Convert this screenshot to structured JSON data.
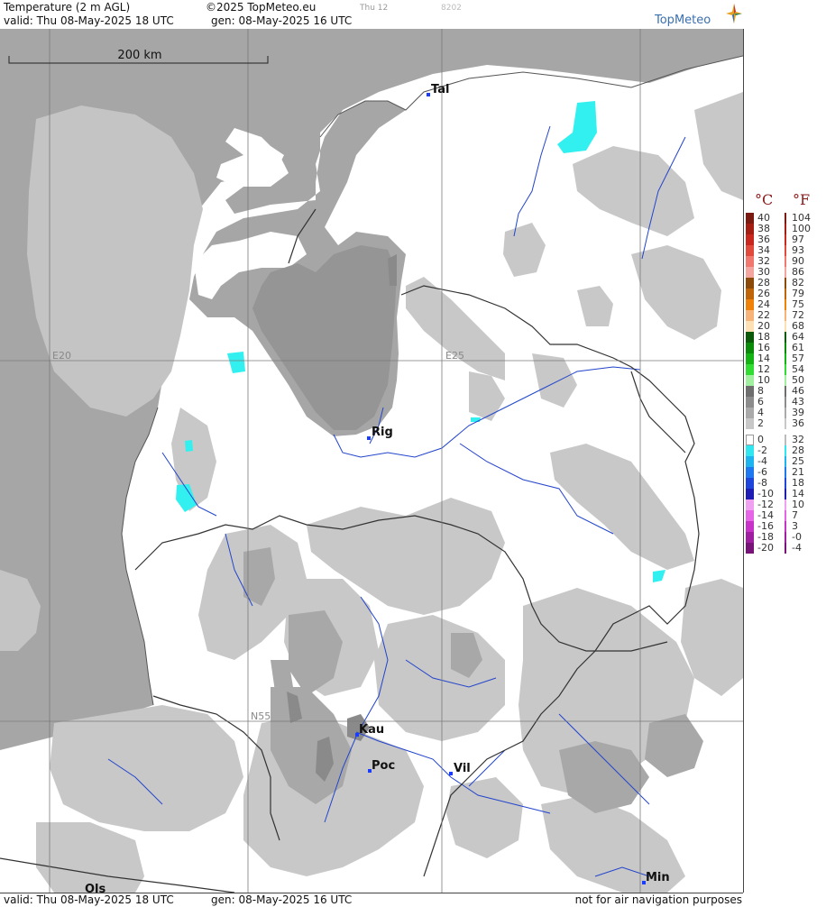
{
  "header": {
    "title": "Temperature (2 m AGL)",
    "copyright": "©2025 TopMeteo.eu",
    "run_label": "Thu 12",
    "code": "8202",
    "valid": "valid:  Thu  08-May-2025  18 UTC",
    "generated": "gen: 08-May-2025 16 UTC",
    "logo": "TopMeteo"
  },
  "map": {
    "scale_label": "200 km",
    "grid_labels": {
      "lon_20": "E20",
      "lon_25": "E25",
      "lat_55": "N55"
    },
    "cities": [
      {
        "label": "Tal"
      },
      {
        "label": "Rig"
      },
      {
        "label": "Kau"
      },
      {
        "label": "Poc"
      },
      {
        "label": "Vil"
      },
      {
        "label": "Min"
      },
      {
        "label": "Ols"
      }
    ],
    "colors": {
      "sea": "#a6a6a6",
      "land_below_2": "#ffffff",
      "land_2_4": "#c8c8c8",
      "land_4_6": "#a8a8a8",
      "land_6_8": "#8a8a8a",
      "frost_zone": "#33f0f0",
      "rivers": "#2244cc",
      "borders": "#333333"
    }
  },
  "footer": {
    "valid": "valid:  Thu  08-May-2025  18 UTC",
    "generated": "gen: 08-May-2025 16 UTC",
    "disclaimer": "not for air navigation purposes"
  },
  "legend": {
    "celsius_label": "°C",
    "fahrenheit_label": "°F",
    "rows": [
      {
        "c": "40",
        "f": "104",
        "color": "#7a1a10"
      },
      {
        "c": "38",
        "f": "100",
        "color": "#a51e14"
      },
      {
        "c": "36",
        "f": "97",
        "color": "#c8281e"
      },
      {
        "c": "34",
        "f": "93",
        "color": "#e04b3c"
      },
      {
        "c": "32",
        "f": "90",
        "color": "#f0786e"
      },
      {
        "c": "30",
        "f": "86",
        "color": "#f5a5a0"
      },
      {
        "c": "28",
        "f": "82",
        "color": "#8c4a0a"
      },
      {
        "c": "26",
        "f": "79",
        "color": "#c0640a"
      },
      {
        "c": "24",
        "f": "75",
        "color": "#f0820a"
      },
      {
        "c": "22",
        "f": "72",
        "color": "#f8b478"
      },
      {
        "c": "20",
        "f": "68",
        "color": "#fde0b4"
      },
      {
        "c": "18",
        "f": "64",
        "color": "#0a5a0a"
      },
      {
        "c": "16",
        "f": "61",
        "color": "#0a8c0a"
      },
      {
        "c": "14",
        "f": "57",
        "color": "#14b414"
      },
      {
        "c": "12",
        "f": "54",
        "color": "#32dc32"
      },
      {
        "c": "10",
        "f": "50",
        "color": "#a0f0a0"
      },
      {
        "c": "8",
        "f": "46",
        "color": "#6e6e6e"
      },
      {
        "c": "6",
        "f": "43",
        "color": "#8c8c8c"
      },
      {
        "c": "4",
        "f": "39",
        "color": "#aaaaaa"
      },
      {
        "c": "2",
        "f": "36",
        "color": "#c8c8c8"
      },
      {
        "c": "0",
        "f": "32",
        "color": "#ffffff"
      },
      {
        "c": "-2",
        "f": "28",
        "color": "#32e6f0"
      },
      {
        "c": "-4",
        "f": "25",
        "color": "#1eb4f0"
      },
      {
        "c": "-6",
        "f": "21",
        "color": "#1e78f0"
      },
      {
        "c": "-8",
        "f": "18",
        "color": "#1e46dc"
      },
      {
        "c": "-10",
        "f": "14",
        "color": "#1e1eb4"
      },
      {
        "c": "-12",
        "f": "10",
        "color": "#f0a0f0"
      },
      {
        "c": "-14",
        "f": "7",
        "color": "#e664e6"
      },
      {
        "c": "-16",
        "f": "3",
        "color": "#c832c8"
      },
      {
        "c": "-18",
        "f": "-0",
        "color": "#a01ea0"
      },
      {
        "c": "-20",
        "f": "-4",
        "color": "#781478"
      }
    ]
  }
}
